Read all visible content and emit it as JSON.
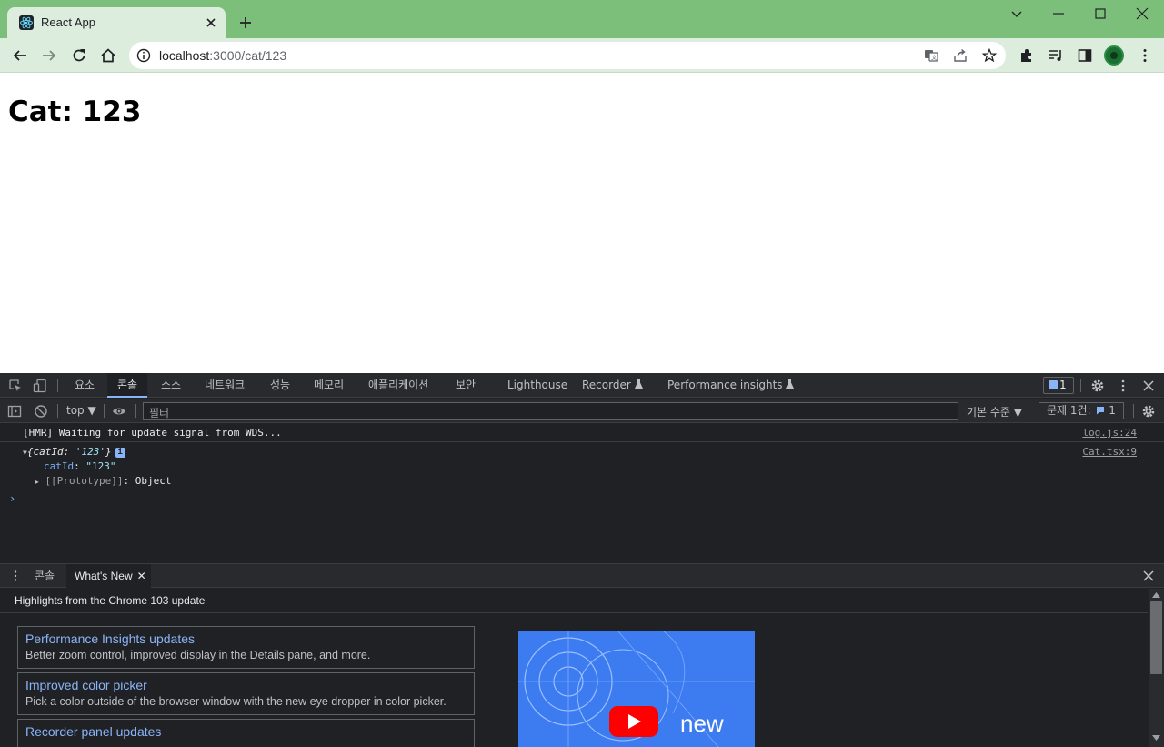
{
  "browser": {
    "tab_title": "React App",
    "url_host": "localhost",
    "url_path": ":3000/cat/123"
  },
  "page": {
    "heading": "Cat: 123"
  },
  "devtools": {
    "tabs": [
      "요소",
      "콘솔",
      "소스",
      "네트워크",
      "성능",
      "메모리",
      "애플리케이션",
      "보안",
      "Lighthouse",
      "Recorder",
      "Performance insights"
    ],
    "active_tab": "콘솔",
    "issues_badge": "1",
    "console_bar": {
      "context": "top",
      "filter_placeholder": "필터",
      "levels": "기본 수준",
      "issue_count_label": "문제 1건:",
      "issue_count": "1"
    },
    "logs": {
      "hmr": "[HMR] Waiting for update signal from WDS...",
      "hmr_src": "log.js:24",
      "obj_key": "catId",
      "obj_val": "'123'",
      "obj_src": "Cat.tsx:9",
      "prop_key": "catId",
      "prop_val": "\"123\"",
      "proto_key": "[[Prototype]]",
      "proto_val": "Object",
      "info_badge": "i"
    },
    "drawer": {
      "tab_console": "콘솔",
      "tab_whats_new": "What's New",
      "header": "Highlights from the Chrome 103 update",
      "cards": [
        {
          "title": "Performance Insights updates",
          "desc": "Better zoom control, improved display in the Details pane, and more."
        },
        {
          "title": "Improved color picker",
          "desc": "Pick a color outside of the browser window with the new eye dropper in color picker."
        },
        {
          "title": "Recorder panel updates",
          "desc": ""
        }
      ],
      "video_label": "new"
    }
  },
  "colors": {
    "tabstrip": "#7bbf7b",
    "toolbar": "#ddeddd",
    "devtools_bg": "#202124",
    "accent": "#8ab4f8"
  }
}
